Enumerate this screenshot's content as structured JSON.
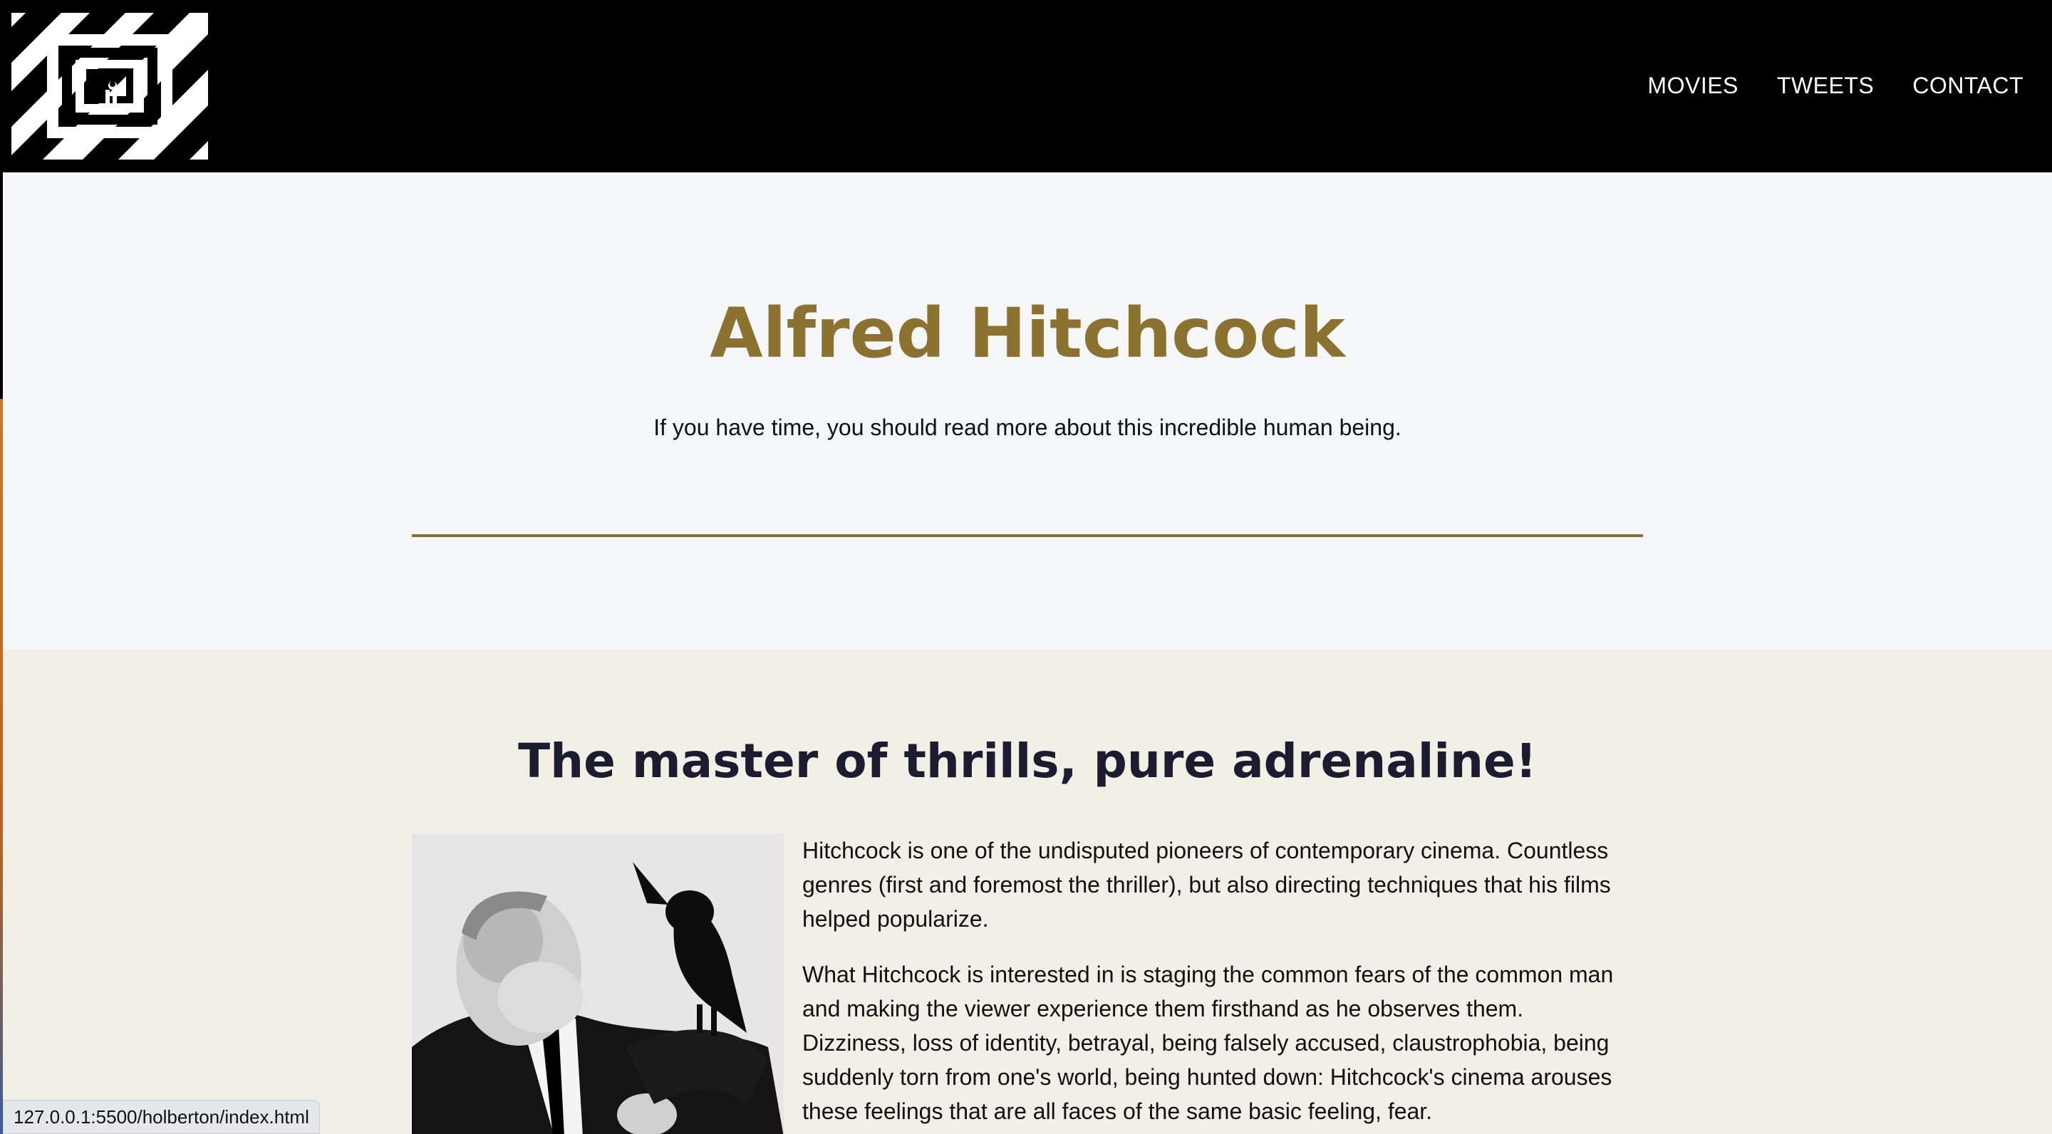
{
  "header": {
    "logo_icon": "spiral-logo-icon",
    "nav": [
      {
        "label": "MOVIES"
      },
      {
        "label": "TWEETS"
      },
      {
        "label": "CONTACT"
      }
    ]
  },
  "hero": {
    "title": "Alfred Hitchcock",
    "subtitle": "If you have time, you should read more about this incredible human being."
  },
  "section": {
    "heading": "The master of thrills, pure adrenaline!",
    "paragraphs": [
      "Hitchcock is one of the undisputed pioneers of contemporary cinema. Countless genres (first and foremost the thriller), but also directing techniques that his films helped popularize.",
      "What Hitchcock is interested in is staging the common fears of the common man and making the viewer experience them firsthand as he observes them. Dizziness, loss of identity, betrayal, being falsely accused, claustrophobia, being suddenly torn from one's world, being hunted down: Hitchcock's cinema arouses these feelings that are all faces of the same basic feeling, fear."
    ]
  },
  "status_bar": {
    "url": "127.0.0.1:5500/holberton/index.html"
  },
  "colors": {
    "accent": "#8c7231",
    "header_bg": "#000000",
    "hero_bg": "#f5f6f7",
    "section_bg": "#f2efe7",
    "heading_text": "#1c1c30"
  }
}
